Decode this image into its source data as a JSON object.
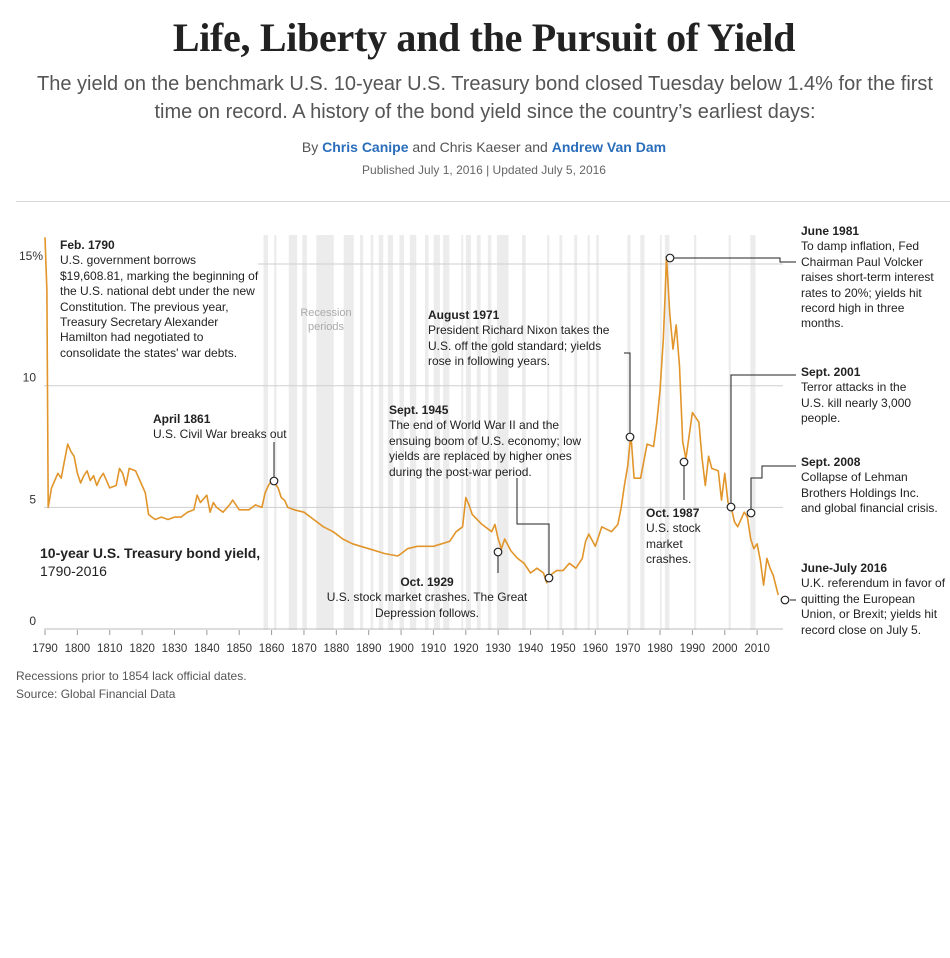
{
  "header": {
    "title": "Life, Liberty and the Pursuit of Yield",
    "dek": "The yield on the benchmark U.S. 10-year U.S. Treasury bond closed Tuesday below 1.4% for the first time on record. A history of the bond yield since the country’s earliest days:",
    "by_prefix": "By",
    "author1": "Chris Canipe",
    "and1": "and Chris Kaeser and",
    "author3": "Andrew Van Dam",
    "published": "Published July 1, 2016 | Updated July 5, 2016"
  },
  "colors": {
    "line": "#e1952a",
    "recession": "#ececec",
    "grid": "#cfcfcf",
    "link": "#2a6ebb"
  },
  "chart_data": {
    "type": "line",
    "title": "10-year U.S. Treasury bond yield,",
    "subtitle": "1790-2016",
    "recession_label": "Recession periods",
    "xlim": [
      1788,
      2017
    ],
    "ylim": [
      0,
      16
    ],
    "x_ticks": [
      1790,
      1800,
      1810,
      1820,
      1830,
      1840,
      1850,
      1860,
      1870,
      1880,
      1890,
      1900,
      1910,
      1920,
      1930,
      1940,
      1950,
      1960,
      1970,
      1980,
      1990,
      2000,
      2010
    ],
    "y_ticks": [
      {
        "value": 0,
        "label": "0"
      },
      {
        "value": 5,
        "label": "5"
      },
      {
        "value": 10,
        "label": "10"
      },
      {
        "value": 15,
        "label": "15%"
      }
    ],
    "recessions": [
      [
        1857.5,
        1858.9
      ],
      [
        1860.8,
        1861.5
      ],
      [
        1865.3,
        1867.9
      ],
      [
        1869.5,
        1870.9
      ],
      [
        1873.8,
        1879.2
      ],
      [
        1882.3,
        1885.4
      ],
      [
        1887.3,
        1888.3
      ],
      [
        1890.6,
        1891.4
      ],
      [
        1893.1,
        1894.5
      ],
      [
        1895.9,
        1897.5
      ],
      [
        1899.5,
        1900.9
      ],
      [
        1902.7,
        1904.7
      ],
      [
        1907.4,
        1908.5
      ],
      [
        1910.1,
        1912.0
      ],
      [
        1913.0,
        1914.9
      ],
      [
        1918.6,
        1919.2
      ],
      [
        1920.0,
        1921.6
      ],
      [
        1923.4,
        1924.6
      ],
      [
        1926.8,
        1927.9
      ],
      [
        1929.6,
        1933.2
      ],
      [
        1937.4,
        1938.5
      ],
      [
        1945.1,
        1945.8
      ],
      [
        1948.9,
        1949.8
      ],
      [
        1953.5,
        1954.4
      ],
      [
        1957.6,
        1958.3
      ],
      [
        1960.3,
        1961.1
      ],
      [
        1969.9,
        1970.9
      ],
      [
        1973.9,
        1975.2
      ],
      [
        1980.0,
        1980.5
      ],
      [
        1981.5,
        1982.9
      ],
      [
        1990.5,
        1991.2
      ],
      [
        2001.2,
        2001.9
      ],
      [
        2007.9,
        2009.5
      ]
    ],
    "series": [
      {
        "x": [
          1790,
          1790.6,
          1791,
          1792,
          1794,
          1795,
          1796,
          1797,
          1798,
          1799,
          1800,
          1801,
          1802,
          1803,
          1804,
          1805,
          1806,
          1807,
          1808,
          1809,
          1810,
          1812,
          1813,
          1814,
          1815,
          1816,
          1818,
          1820,
          1821,
          1822,
          1824,
          1826,
          1828,
          1830,
          1832,
          1834,
          1836,
          1837,
          1838,
          1840,
          1841,
          1842,
          1843,
          1845,
          1847,
          1848,
          1850,
          1853,
          1855,
          1857,
          1858,
          1859,
          1860,
          1861,
          1862,
          1863,
          1864,
          1865,
          1867,
          1870,
          1873,
          1876,
          1879,
          1882,
          1885,
          1890,
          1895,
          1899,
          1900,
          1902,
          1905,
          1910,
          1915,
          1917,
          1919,
          1920,
          1921,
          1922,
          1925,
          1928,
          1929,
          1930,
          1931,
          1932,
          1934,
          1936,
          1938,
          1940,
          1942,
          1944,
          1945,
          1946,
          1947,
          1948,
          1950,
          1952,
          1954,
          1956,
          1957,
          1958,
          1960,
          1962,
          1965,
          1967,
          1968,
          1969,
          1970,
          1971,
          1972,
          1974,
          1976,
          1978,
          1979,
          1980,
          1981,
          1981.5,
          1982,
          1983,
          1984,
          1985,
          1986,
          1987,
          1988,
          1990,
          1992,
          1993,
          1994,
          1995,
          1996,
          1998,
          1999,
          2000,
          2001,
          2002,
          2003,
          2004,
          2006,
          2007,
          2008,
          2009,
          2010,
          2011,
          2012,
          2013,
          2014,
          2015,
          2016.5
        ],
        "y": [
          16.1,
          13.9,
          5.0,
          5.8,
          6.4,
          6.2,
          6.9,
          7.6,
          7.3,
          7.1,
          6.4,
          6.0,
          6.3,
          6.5,
          6.1,
          6.3,
          5.9,
          6.2,
          6.4,
          6.1,
          5.8,
          5.9,
          6.6,
          6.4,
          5.9,
          6.6,
          6.5,
          5.9,
          5.6,
          4.7,
          4.5,
          4.6,
          4.5,
          4.6,
          4.6,
          4.8,
          4.9,
          5.5,
          5.2,
          5.5,
          4.8,
          5.2,
          5.0,
          4.8,
          5.1,
          5.3,
          4.9,
          4.9,
          5.1,
          5.0,
          5.6,
          5.9,
          6.1,
          6.0,
          5.8,
          5.4,
          5.3,
          5.0,
          4.9,
          4.8,
          4.5,
          4.2,
          4.0,
          3.7,
          3.5,
          3.3,
          3.1,
          3.0,
          3.1,
          3.3,
          3.4,
          3.4,
          3.6,
          4.0,
          4.2,
          5.4,
          5.1,
          4.7,
          4.3,
          4.0,
          4.3,
          3.7,
          3.3,
          3.7,
          3.2,
          2.9,
          2.7,
          2.3,
          2.5,
          2.3,
          1.9,
          2.2,
          2.3,
          2.4,
          2.4,
          2.7,
          2.5,
          2.9,
          3.6,
          3.9,
          3.4,
          4.2,
          4.0,
          4.3,
          5.0,
          5.9,
          6.7,
          8.0,
          6.2,
          6.2,
          7.6,
          7.5,
          8.5,
          9.8,
          11.9,
          13.5,
          15.3,
          13.0,
          11.5,
          12.5,
          10.8,
          7.7,
          7.0,
          8.9,
          8.5,
          7.0,
          5.9,
          7.1,
          6.6,
          6.5,
          5.3,
          6.4,
          5.2,
          5.0,
          4.4,
          4.2,
          4.8,
          4.6,
          3.7,
          3.3,
          3.5,
          2.8,
          1.8,
          2.9,
          2.5,
          2.2,
          1.4
        ]
      }
    ]
  },
  "annotations": {
    "feb1790": {
      "title": "Feb. 1790",
      "body": "U.S. government borrows $19,608.81, marking the beginning of the U.S. national debt under the new Constitution. The previous year, Treasury Secretary Alexander Hamilton had negotiated to consolidate the states' war debts."
    },
    "apr1861": {
      "title": "April 1861",
      "body": "U.S. Civil War breaks out"
    },
    "oct1929": {
      "title": "Oct. 1929",
      "body": "U.S. stock market crashes. The Great Depression follows."
    },
    "sept1945": {
      "title": "Sept. 1945",
      "body": "The end of World War II and the ensuing boom of U.S. economy; low yields are replaced by higher ones during the post-war period."
    },
    "aug1971": {
      "title": "August 1971",
      "body": "President Richard Nixon takes the U.S. off the gold standard; yields rose in following years."
    },
    "oct1987": {
      "title": "Oct. 1987",
      "body": "U.S. stock market crashes."
    },
    "jun1981": {
      "title": "June 1981",
      "body": "To damp inflation, Fed Chairman Paul Volcker raises short-term interest rates to 20%; yields hit record high in three months."
    },
    "sep2001": {
      "title": "Sept. 2001",
      "body": "Terror attacks in the U.S. kill nearly 3,000 people."
    },
    "sep2008": {
      "title": "Sept. 2008",
      "body": "Collapse of Lehman Brothers Holdings Inc. and global financial crisis."
    },
    "jun2016": {
      "title": "June-July 2016",
      "body": "U.K. referendum in favor of quitting the European Union, or Brexit; yields hit record close on July 5."
    }
  },
  "footer": {
    "note": "Recessions prior to 1854 lack official dates.",
    "source": "Source: Global Financial Data"
  }
}
